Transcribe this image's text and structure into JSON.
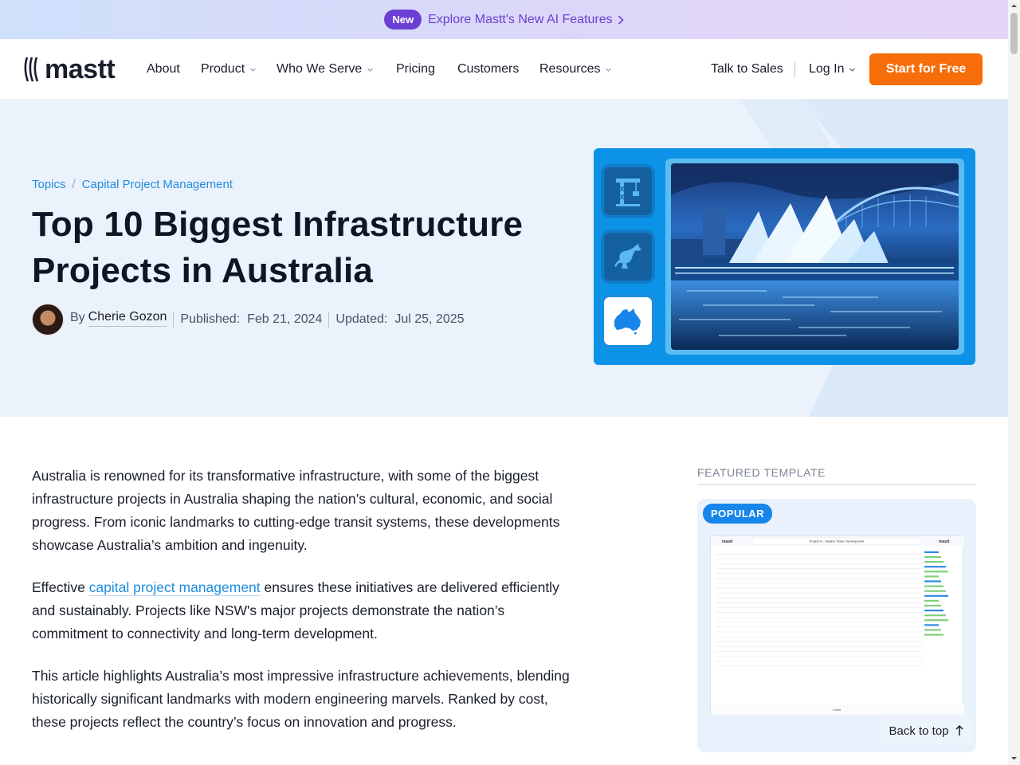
{
  "announcement": {
    "badge": "New",
    "link_text": "Explore Mastt's New AI Features"
  },
  "nav": {
    "logo_text": "mastt",
    "items": [
      {
        "label": "About",
        "dropdown": false
      },
      {
        "label": "Product",
        "dropdown": true
      },
      {
        "label": "Who We Serve",
        "dropdown": true
      },
      {
        "label": "Pricing",
        "dropdown": false
      },
      {
        "label": "Customers",
        "dropdown": false
      },
      {
        "label": "Resources",
        "dropdown": true
      }
    ],
    "talk_to_sales": "Talk to Sales",
    "login": "Log In",
    "cta": "Start for Free"
  },
  "hero": {
    "breadcrumb": [
      "Topics",
      "Capital Project Management"
    ],
    "title": "Top 10 Biggest Infrastructure Projects in Australia",
    "author_prefix": "By",
    "author": "Cherie Gozon",
    "published_label": "Published:",
    "published_date": "Feb 21, 2024",
    "updated_label": "Updated:",
    "updated_date": "Jul 25, 2025",
    "icons": [
      "crane-icon",
      "kangaroo-icon",
      "australia-map-icon"
    ]
  },
  "article": {
    "p1": "Australia is renowned for its transformative infrastructure, with some of the biggest infrastructure projects in Australia shaping the nation’s cultural, economic, and social progress. From iconic landmarks to cutting-edge transit systems, these developments showcase Australia’s ambition and ingenuity.",
    "p2_before": "Effective ",
    "p2_link": "capital project management",
    "p2_after": " ensures these initiatives are delivered efficiently and sustainably. Projects like NSW's major projects demonstrate the nation’s commitment to connectivity and long-term development.",
    "p3": "This article highlights Australia’s most impressive infrastructure achievements, blending historically significant landmarks with modern engineering marvels. Ranked by cost, these projects reflect the country’s focus on innovation and progress."
  },
  "sidebar": {
    "label": "FEATURED TEMPLATE",
    "badge": "POPULAR",
    "template_title": "Project A - Skyline Tower Development"
  },
  "back_to_top": "Back to top",
  "colors": {
    "accent_orange": "#f66d0a",
    "link_blue": "#1f8de0",
    "brand_purple": "#6b3fd4"
  }
}
